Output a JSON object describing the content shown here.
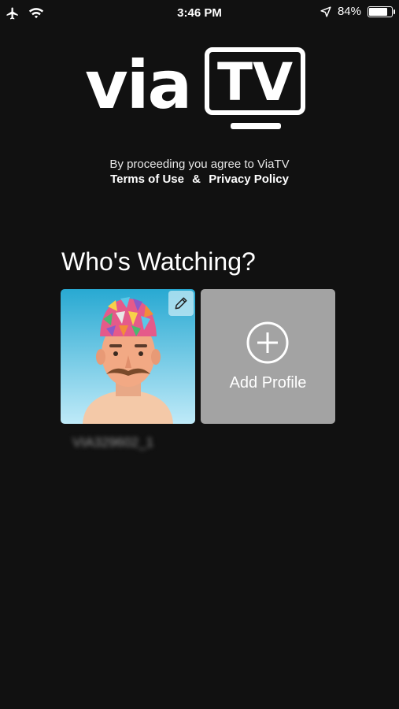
{
  "status_bar": {
    "time": "3:46 PM",
    "battery_percent": "84%",
    "battery_level": 0.84,
    "icons": [
      "airplane-icon",
      "wifi-icon",
      "location-arrow-icon",
      "battery-icon"
    ]
  },
  "logo": {
    "via": "via",
    "tv": "TV"
  },
  "terms": {
    "intro": "By proceeding you agree to ViaTV",
    "terms_of_use": "Terms of Use",
    "ampersand": "&",
    "privacy_policy": "Privacy Policy"
  },
  "heading": "Who's Watching?",
  "profiles": [
    {
      "name": "VIA329602_1",
      "icon": "pencil-icon"
    }
  ],
  "add_profile": {
    "label": "Add Profile",
    "icon": "plus-circle-icon"
  },
  "colors": {
    "background": "#111111",
    "add_card": "#a3a3a3",
    "avatar_bg": "#28a9d2"
  }
}
